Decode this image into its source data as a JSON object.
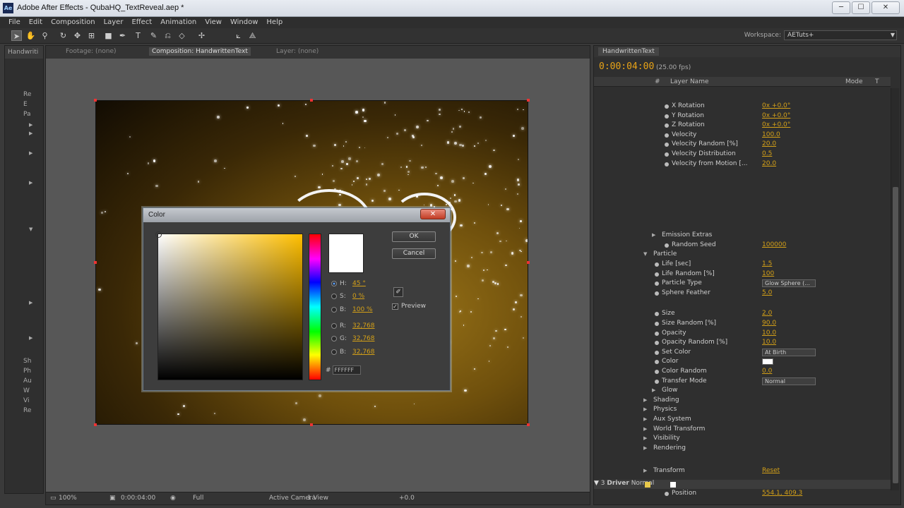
{
  "window": {
    "title": "Adobe After Effects - QubaHQ_TextReveal.aep *",
    "app_icon": "Ae",
    "min": "─",
    "max": "☐",
    "close": "✕"
  },
  "menu": [
    "File",
    "Edit",
    "Composition",
    "Layer",
    "Effect",
    "Animation",
    "View",
    "Window",
    "Help"
  ],
  "toolbar": {
    "workspace_label": "Workspace:",
    "workspace_value": "AETuts+"
  },
  "left_panel": {
    "tab": "Handwriti",
    "items": [
      "Re",
      "E",
      "Pa",
      "Sh",
      "Ph",
      "Au",
      "W",
      "Vi",
      "Re"
    ]
  },
  "comp_panel": {
    "tabs": [
      "Footage: (none)",
      "Composition: HandwrittenText",
      "Layer: (none)"
    ],
    "bottom": {
      "zoom": "100%",
      "timecode": "0:00:04:00",
      "resolution": "Full",
      "camera": "Active Camera",
      "views": "1 View",
      "exposure": "+0.0"
    }
  },
  "color_dialog": {
    "title": "Color",
    "close": "✕",
    "ok": "OK",
    "cancel": "Cancel",
    "fields": [
      {
        "key": "H:",
        "value": "45 °",
        "selected": true
      },
      {
        "key": "S:",
        "value": "0 %",
        "selected": false
      },
      {
        "key": "B:",
        "value": "100 %",
        "selected": false
      },
      {
        "key": "R:",
        "value": "32,768",
        "selected": false
      },
      {
        "key": "G:",
        "value": "32,768",
        "selected": false
      },
      {
        "key": "B:",
        "value": "32,768",
        "selected": false
      }
    ],
    "hex_prefix": "#",
    "hex": "FFFFFF",
    "preview_label": "Preview",
    "current_color": "#ffffff",
    "hue_color": "#ffbf00"
  },
  "timeline": {
    "tab": "HandwrittenText",
    "time": "0:00:04:00",
    "fps": "(25.00 fps)",
    "header": {
      "num": "#",
      "layer_name": "Layer Name",
      "mode": "Mode",
      "t": "T"
    },
    "rows": [
      {
        "name": "X Rotation",
        "value": "0x +0.0°",
        "indent": 2
      },
      {
        "name": "Y Rotation",
        "value": "0x +0.0°",
        "indent": 2
      },
      {
        "name": "Z Rotation",
        "value": "0x +0.0°",
        "indent": 2
      },
      {
        "name": "Velocity",
        "value": "100.0",
        "indent": 2
      },
      {
        "name": "Velocity Random [%]",
        "value": "20.0",
        "indent": 2
      },
      {
        "name": "Velocity Distribution",
        "value": "0.5",
        "indent": 2
      },
      {
        "name": "Velocity from Motion [...",
        "value": "20.0",
        "indent": 2
      },
      {
        "name": "Emission Extras",
        "value": "",
        "indent": 1,
        "twisty": "▶"
      },
      {
        "name": "Random Seed",
        "value": "100000",
        "indent": 2
      },
      {
        "name": "Particle",
        "value": "",
        "indent": 0,
        "twisty": "▼"
      },
      {
        "name": "Life [sec]",
        "value": "1.5",
        "indent": 1
      },
      {
        "name": "Life Random [%]",
        "value": "100",
        "indent": 1
      },
      {
        "name": "Particle Type",
        "value": "",
        "dropdown": "Glow Sphere (...",
        "indent": 1
      },
      {
        "name": "Sphere Feather",
        "value": "5.0",
        "indent": 1
      },
      {
        "name": "Size",
        "value": "2.0",
        "indent": 1
      },
      {
        "name": "Size Random [%]",
        "value": "90.0",
        "indent": 1
      },
      {
        "name": "Opacity",
        "value": "10.0",
        "indent": 1
      },
      {
        "name": "Opacity Random [%]",
        "value": "10.0",
        "indent": 1
      },
      {
        "name": "Set Color",
        "value": "",
        "dropdown": "At Birth",
        "indent": 1
      },
      {
        "name": "Color",
        "value": "",
        "swatch": true,
        "indent": 1
      },
      {
        "name": "Color Random",
        "value": "0.0",
        "indent": 1
      },
      {
        "name": "Transfer Mode",
        "value": "",
        "dropdown": "Normal",
        "indent": 1
      },
      {
        "name": "Glow",
        "value": "",
        "indent": 1,
        "twisty": "▶"
      },
      {
        "name": "Shading",
        "value": "",
        "indent": 0,
        "twisty": "▶"
      },
      {
        "name": "Physics",
        "value": "",
        "indent": 0,
        "twisty": "▶"
      },
      {
        "name": "Aux System",
        "value": "",
        "indent": 0,
        "twisty": "▶"
      },
      {
        "name": "World Transform",
        "value": "",
        "indent": 0,
        "twisty": "▶"
      },
      {
        "name": "Visibility",
        "value": "",
        "indent": 0,
        "twisty": "▶"
      },
      {
        "name": "Rendering",
        "value": "",
        "indent": 0,
        "twisty": "▶"
      }
    ],
    "transform": {
      "name": "Transform",
      "reset": "Reset"
    },
    "driver": {
      "num": "3",
      "name": "Driver",
      "mode": "Normal"
    },
    "position": {
      "name": "Position",
      "value": "554.1, 409.3"
    }
  }
}
